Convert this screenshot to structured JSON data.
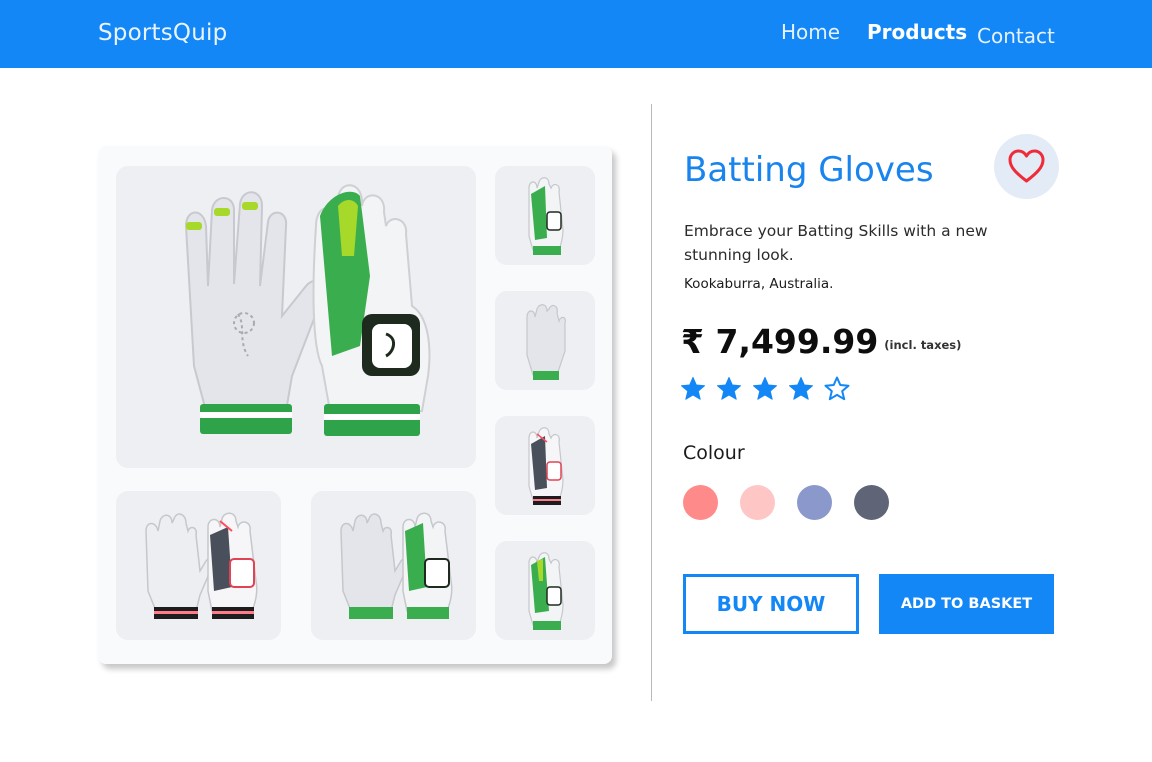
{
  "header": {
    "brand": "SportsQuip",
    "nav": [
      "Home",
      "Products",
      "Contact"
    ],
    "active": "Products"
  },
  "product": {
    "title": "Batting Gloves",
    "description": "Embrace your Batting Skills with a new stunning look.",
    "maker": "Kookaburra, Australia.",
    "price": "₹ 7,499.99",
    "price_note": "(incl. taxes)",
    "rating": 4,
    "rating_max": 5,
    "colour_label": "Colour",
    "colours": [
      "#ff8a8a",
      "#ffc6c6",
      "#8a98cc",
      "#5f6476"
    ]
  },
  "actions": {
    "buy_now": "BUY NOW",
    "add_to_basket": "ADD TO BASKET"
  },
  "colors": {
    "accent": "#1487f6",
    "heart": "#ef2b3a"
  },
  "gallery": {
    "images": [
      "green-gloves-pair",
      "white-red-gloves-pair",
      "green-gloves-pair",
      "green-glove-back",
      "white-glove-palm",
      "white-red-glove",
      "green-glove-front"
    ]
  }
}
